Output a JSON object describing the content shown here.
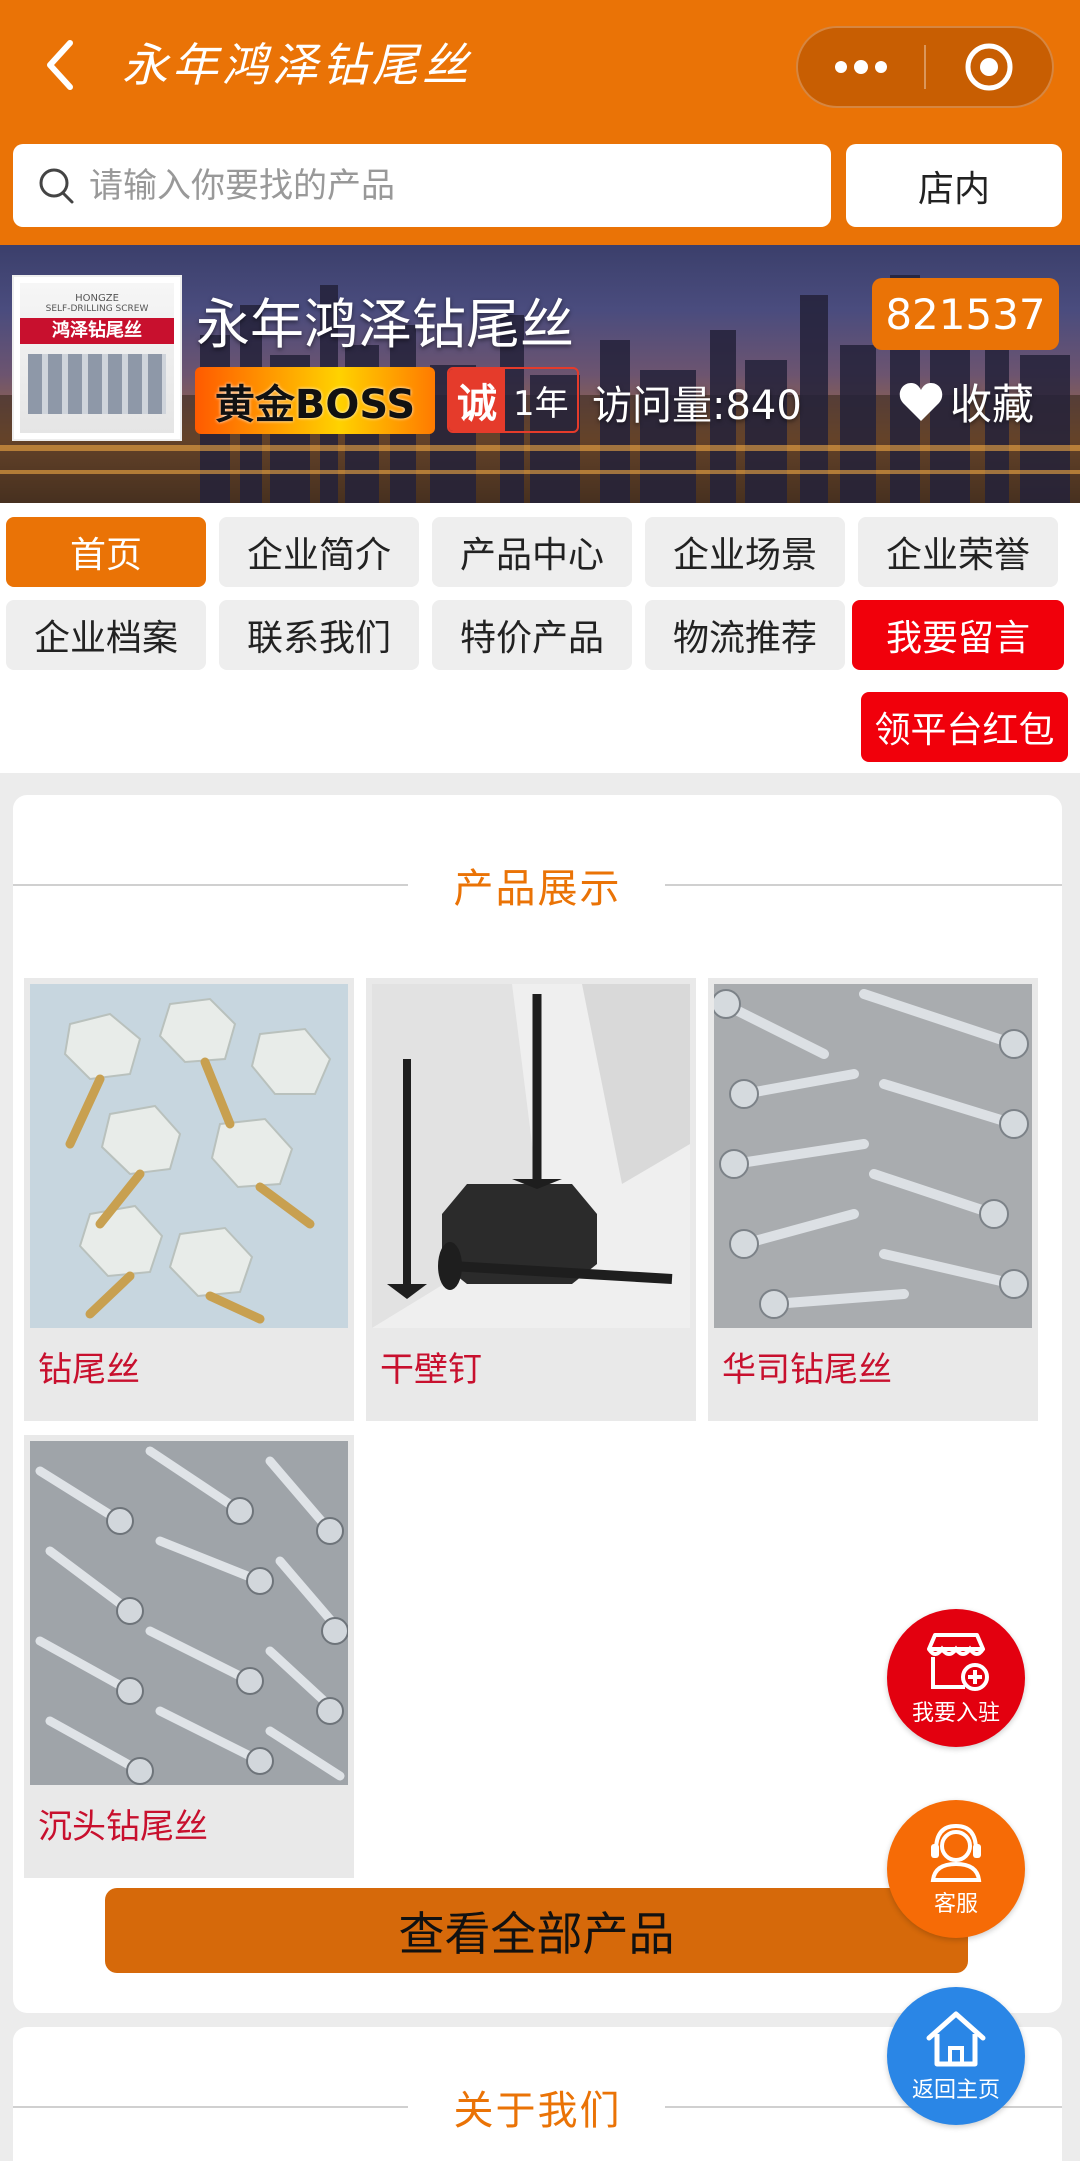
{
  "header": {
    "title": "永年鸿泽钻尾丝",
    "back_icon": "chevron-left-icon",
    "more_icon": "more-dots-icon",
    "close_icon": "target-circle-icon"
  },
  "search": {
    "placeholder": "请输入你要找的产品",
    "store_button": "店内"
  },
  "shop": {
    "name": "永年鸿泽钻尾丝",
    "id": "821537",
    "level_badge": "黄金BOSS",
    "cheng_char": "诚",
    "cheng_years": "1年",
    "visits": "访问量:840",
    "favorite_label": "收藏",
    "logo": {
      "brand_cn": "鸿泽钻尾丝",
      "brand_en": "HONGZE",
      "subtitle": "SELF-DRILLING SCREW"
    }
  },
  "nav": {
    "items": [
      {
        "label": "首页"
      },
      {
        "label": "企业简介"
      },
      {
        "label": "产品中心"
      },
      {
        "label": "企业场景"
      },
      {
        "label": "企业荣誉"
      },
      {
        "label": "企业档案"
      },
      {
        "label": "联系我们"
      },
      {
        "label": "特价产品"
      },
      {
        "label": "物流推荐"
      },
      {
        "label": "我要留言"
      }
    ],
    "red_packet": "领平台红包"
  },
  "products": {
    "section_title": "产品展示",
    "items": [
      {
        "name": "钻尾丝"
      },
      {
        "name": "干壁钉"
      },
      {
        "name": "华司钻尾丝"
      },
      {
        "name": "沉头钻尾丝"
      }
    ],
    "view_all": "查看全部产品"
  },
  "about": {
    "section_title": "关于我们"
  },
  "fabs": {
    "join": "我要入驻",
    "service": "客服",
    "home": "返回主页"
  },
  "colors": {
    "brand_orange": "#ea7306",
    "red": "#f1000b",
    "product_name": "#c8102e",
    "home_blue": "#2a86e6"
  }
}
